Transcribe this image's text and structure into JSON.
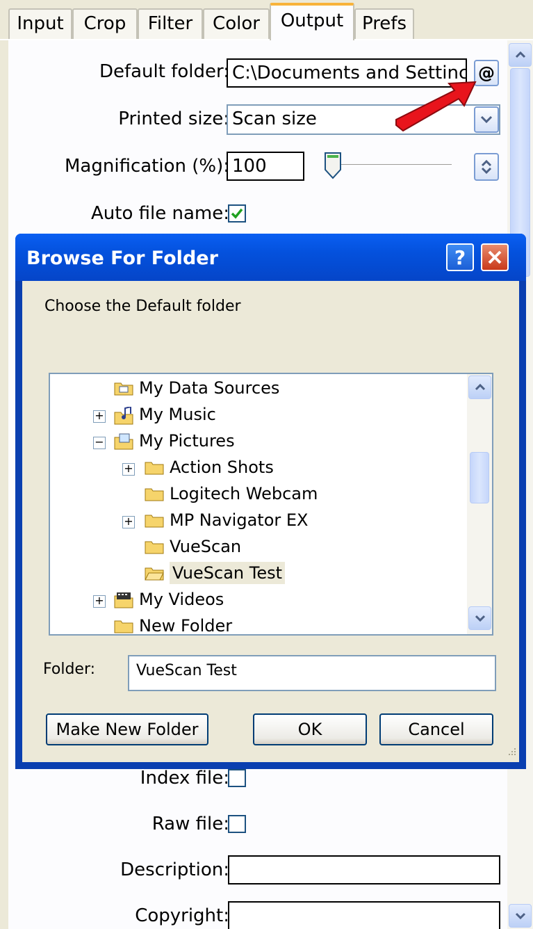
{
  "tabs": [
    "Input",
    "Crop",
    "Filter",
    "Color",
    "Output",
    "Prefs"
  ],
  "active_tab": "Output",
  "form": {
    "default_folder_label": "Default folder:",
    "default_folder_value": "C:\\Documents and Settinc",
    "browse_button_label": "@",
    "printed_size_label": "Printed size:",
    "printed_size_value": "Scan size",
    "magnification_label": "Magnification (%):",
    "magnification_value": "100",
    "auto_file_name_label": "Auto file name:",
    "index_file_label": "Index file:",
    "raw_file_label": "Raw file:",
    "description_label": "Description:",
    "copyright_label": "Copyright:"
  },
  "dialog": {
    "title": "Browse For Folder",
    "help_label": "?",
    "instruction": "Choose the Default folder",
    "tree_items": [
      {
        "label": "My Data Sources",
        "expander": "",
        "icon": "data-sources-folder-icon"
      },
      {
        "label": "My Music",
        "expander": "+",
        "icon": "music-folder-icon"
      },
      {
        "label": "My Pictures",
        "expander": "−",
        "icon": "pictures-folder-icon"
      },
      {
        "label": "Action Shots",
        "expander": "+",
        "icon": "folder-icon"
      },
      {
        "label": "Logitech Webcam",
        "expander": "",
        "icon": "folder-icon"
      },
      {
        "label": "MP Navigator EX",
        "expander": "+",
        "icon": "folder-icon"
      },
      {
        "label": "VueScan",
        "expander": "",
        "icon": "folder-icon"
      },
      {
        "label": "VueScan Test",
        "expander": "",
        "icon": "folder-icon"
      },
      {
        "label": "My Videos",
        "expander": "+",
        "icon": "videos-folder-icon"
      },
      {
        "label": "New Folder",
        "expander": "",
        "icon": "folder-icon"
      }
    ],
    "selected_item": "VueScan Test",
    "folder_label": "Folder:",
    "folder_value": "VueScan Test",
    "make_new_folder_label": "Make New Folder",
    "ok_label": "OK",
    "cancel_label": "Cancel"
  },
  "colors": {
    "title_bar": "#0a5ff2",
    "arrow": "#e8141c",
    "close": "#e35a2e",
    "tab_accent": "#f8b33a"
  }
}
